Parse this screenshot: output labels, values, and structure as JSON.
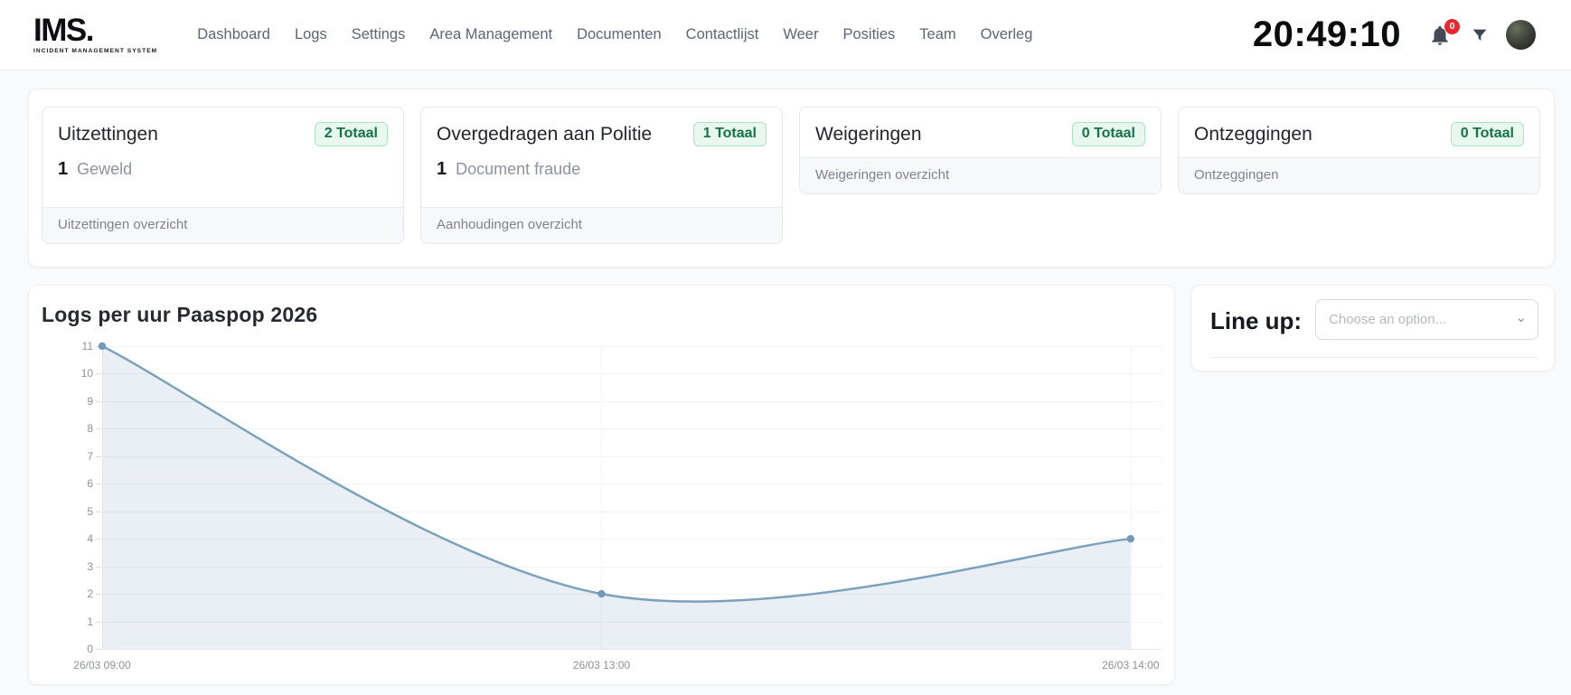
{
  "header": {
    "logo_title": "IMS.",
    "logo_subtitle": "INCIDENT MANAGEMENT SYSTEM",
    "nav": [
      "Dashboard",
      "Logs",
      "Settings",
      "Area Management",
      "Documenten",
      "Contactlijst",
      "Weer",
      "Posities",
      "Team",
      "Overleg"
    ],
    "clock": "20:49:10",
    "notification_badge": "0"
  },
  "stat_cards": [
    {
      "title": "Uitzettingen",
      "badge": "2 Totaal",
      "count": "1",
      "count_label": "Geweld",
      "footer": "Uitzettingen overzicht"
    },
    {
      "title": "Overgedragen aan Politie",
      "badge": "1 Totaal",
      "count": "1",
      "count_label": "Document fraude",
      "footer": "Aanhoudingen overzicht"
    },
    {
      "title": "Weigeringen",
      "badge": "0 Totaal",
      "footer": "Weigeringen overzicht"
    },
    {
      "title": "Ontzeggingen",
      "badge": "0 Totaal",
      "footer": "Ontzeggingen"
    }
  ],
  "chart_data": {
    "type": "area",
    "title": "Logs per uur Paaspop 2026",
    "x_labels": [
      "26/03 09:00",
      "26/03 13:00",
      "26/03 14:00"
    ],
    "values": [
      11,
      2,
      4
    ],
    "ylim": [
      0,
      11
    ],
    "yticks": [
      0,
      1,
      2,
      3,
      4,
      5,
      6,
      7,
      8,
      9,
      10,
      11
    ],
    "x_positions": [
      0,
      0.471,
      0.97
    ],
    "grid": true,
    "legend": "none",
    "line_color": "#7ba1bc",
    "marker_color": "#6f9ab8",
    "fill_color": "rgba(123,161,188,0.17)"
  },
  "lineup": {
    "label": "Line up:",
    "placeholder": "Choose an option..."
  },
  "colors": {
    "badge_green": "#157347",
    "badge_bg": "#e9f8ef",
    "accent_red": "#e8282d"
  }
}
